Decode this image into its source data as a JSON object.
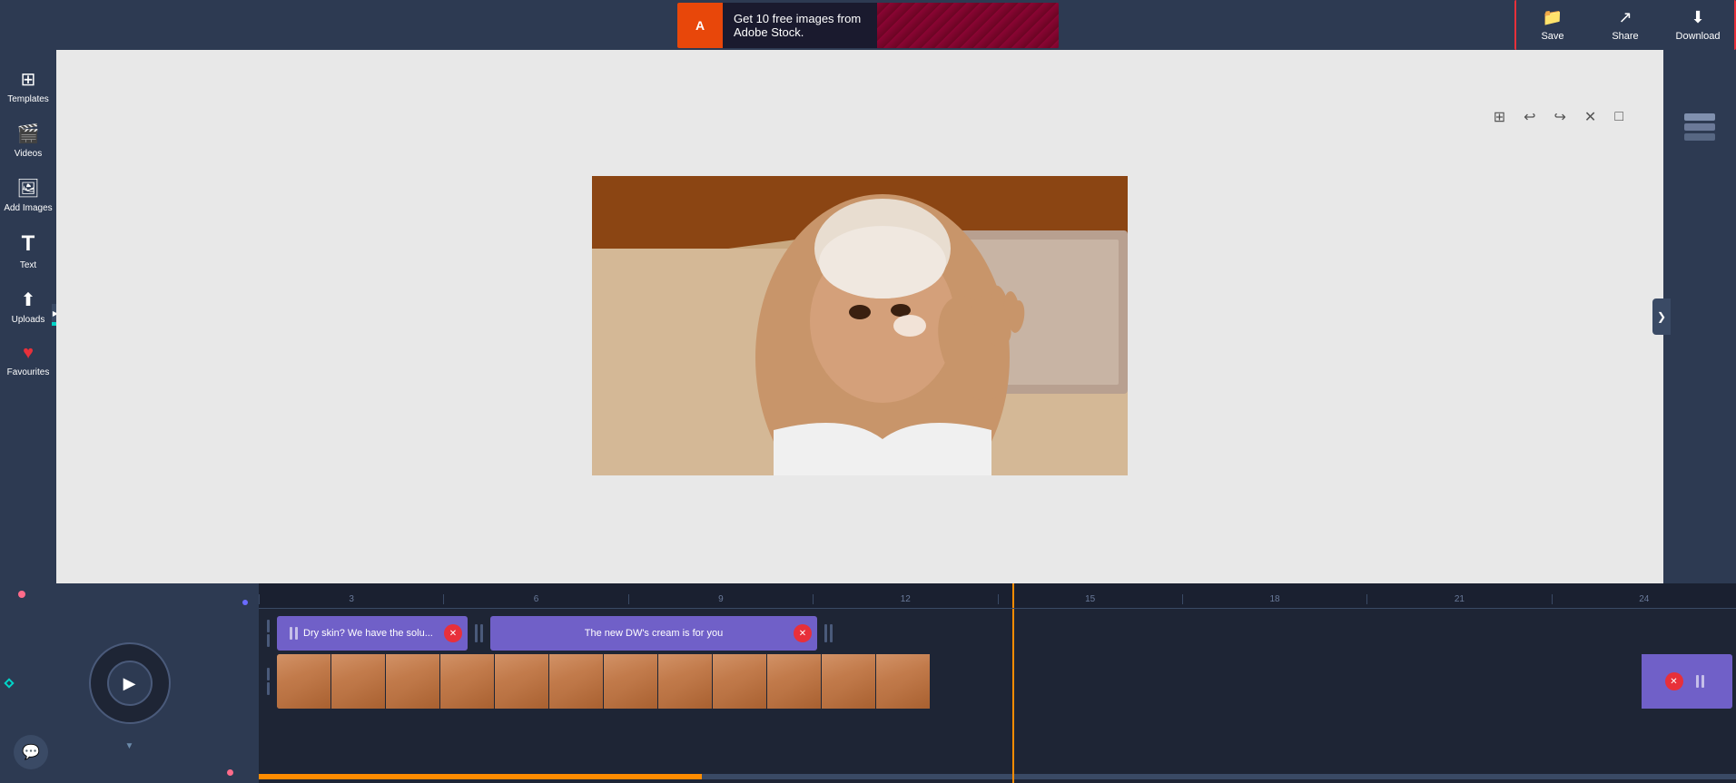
{
  "topBar": {
    "adText": "Get 10 free images from Adobe Stock.",
    "adBrand": "Adobe",
    "buttons": {
      "save": "Save",
      "share": "Share",
      "download": "Download"
    }
  },
  "sidebar": {
    "items": [
      {
        "id": "templates",
        "label": "Templates",
        "icon": "⊞"
      },
      {
        "id": "videos",
        "label": "Videos",
        "icon": "🎬"
      },
      {
        "id": "add-images",
        "label": "Add Images",
        "icon": "🖼"
      },
      {
        "id": "text",
        "label": "Text",
        "icon": "T"
      },
      {
        "id": "uploads",
        "label": "Uploads",
        "icon": "⬆"
      },
      {
        "id": "favourites",
        "label": "Favourites",
        "icon": "♥"
      }
    ]
  },
  "canvas": {
    "tools": {
      "grid": "⊞",
      "undo": "↩",
      "redo": "↪",
      "close": "✕",
      "expand": "□"
    }
  },
  "timeline": {
    "rulerMarks": [
      "3",
      "6",
      "9",
      "12",
      "15",
      "18",
      "21",
      "24"
    ],
    "textTrack1": {
      "text": "Dry skin? We have the solu...",
      "color": "#7060c8"
    },
    "textTrack2": {
      "text": "The new DW's cream is for you",
      "color": "#7060c8"
    }
  },
  "colors": {
    "accent": "#00d4c8",
    "orange": "#ff8c00",
    "red": "#e8303a",
    "purple": "#7060c8",
    "bg": "#2d3a52",
    "dark": "#1e2535"
  }
}
